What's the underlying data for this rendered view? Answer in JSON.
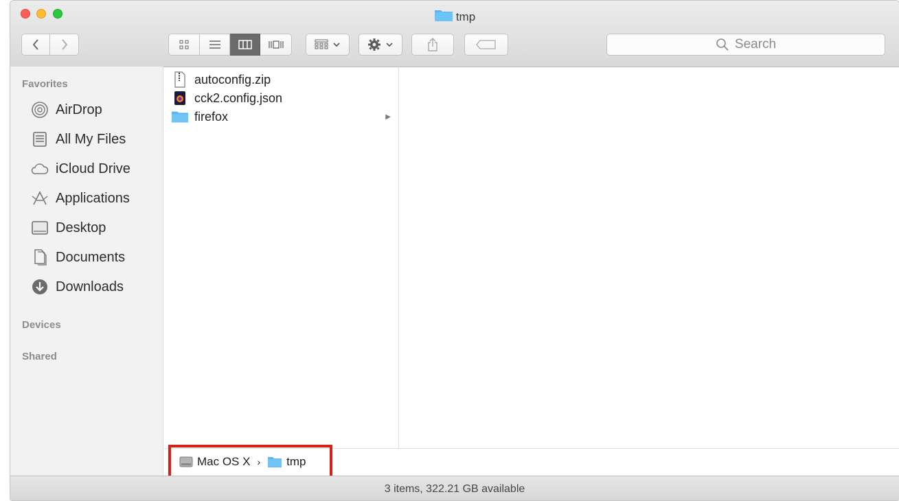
{
  "window": {
    "title": "tmp"
  },
  "toolbar": {
    "back_label": "‹",
    "forward_label": "›",
    "search_placeholder": "Search"
  },
  "sidebar": {
    "favorites_header": "Favorites",
    "items": [
      {
        "label": "AirDrop",
        "icon": "airdrop-icon"
      },
      {
        "label": "All My Files",
        "icon": "all-files-icon"
      },
      {
        "label": "iCloud Drive",
        "icon": "cloud-icon"
      },
      {
        "label": "Applications",
        "icon": "applications-icon"
      },
      {
        "label": "Desktop",
        "icon": "desktop-icon"
      },
      {
        "label": "Documents",
        "icon": "documents-icon"
      },
      {
        "label": "Downloads",
        "icon": "downloads-icon"
      }
    ],
    "devices_header": "Devices",
    "shared_header": "Shared"
  },
  "files": [
    {
      "name": "autoconfig.zip",
      "icon": "zip-file-icon"
    },
    {
      "name": "cck2.config.json",
      "icon": "firefox-json-icon"
    },
    {
      "name": "firefox",
      "icon": "folder-icon",
      "has_children": true
    }
  ],
  "pathbar": {
    "volume": "Mac OS X",
    "folder": "tmp"
  },
  "status": {
    "text": "3 items, 322.21 GB available"
  },
  "colors": {
    "highlight": "#d42218",
    "folder_blue": "#5ab6f0"
  }
}
